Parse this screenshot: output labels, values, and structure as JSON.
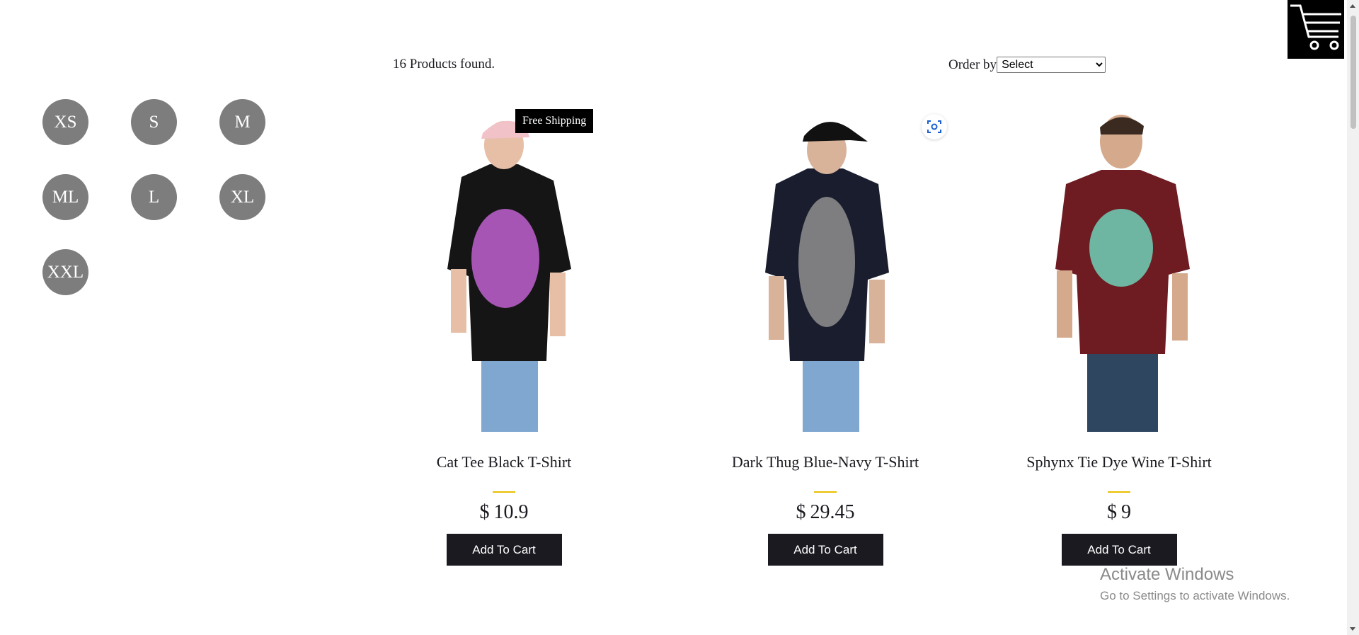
{
  "filters": {
    "sizes": [
      "XS",
      "S",
      "M",
      "ML",
      "L",
      "XL",
      "XXL"
    ]
  },
  "shelf": {
    "products_found": "16 Products found.",
    "order_by_label": "Order by",
    "order_by_selected": "Select"
  },
  "products": [
    {
      "title": "Cat Tee Black T-Shirt",
      "currency": "$",
      "price": "10.9",
      "add_label": "Add To Cart",
      "tag": "Free Shipping",
      "shirt_color": "#151515",
      "print_color": "#c060d0"
    },
    {
      "title": "Dark Thug Blue-Navy T-Shirt",
      "currency": "$",
      "price": "29.45",
      "add_label": "Add To Cart",
      "shirt_color": "#1a1d2e",
      "print_color": "#8a8a8a"
    },
    {
      "title": "Sphynx Tie Dye Wine T-Shirt",
      "currency": "$",
      "price": "9",
      "add_label": "Add To Cart",
      "shirt_color": "#6e1b22",
      "print_color": "#6ec6b0"
    }
  ],
  "cart": {
    "icon": "cart-icon"
  },
  "system": {
    "watermark_title": "Activate Windows",
    "watermark_subtitle": "Go to Settings to activate Windows."
  },
  "colors": {
    "accent": "#eabf00",
    "button": "#1b1a20",
    "size_chip": "#7d7d7d"
  }
}
